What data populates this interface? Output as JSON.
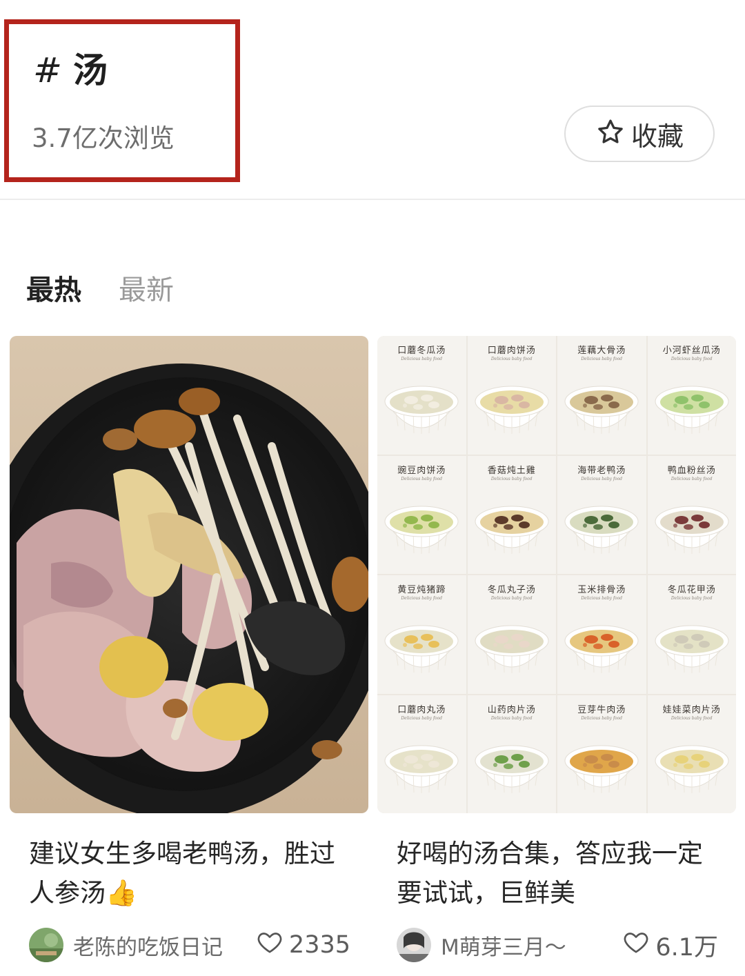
{
  "header": {
    "hash": "#",
    "title": "汤",
    "views": "3.7亿次浏览",
    "collect_label": "收藏"
  },
  "tabs": [
    {
      "label": "最热",
      "active": true
    },
    {
      "label": "最新",
      "active": false
    }
  ],
  "cards": [
    {
      "title": "建议女生多喝老鸭汤，胜过人参汤👍",
      "author": "老陈的吃饭日记",
      "likes": "2335"
    },
    {
      "title": "好喝的汤合集，答应我一定要试试，巨鲜美",
      "author": "M萌芽三月～",
      "likes": "6.1万",
      "grid": [
        {
          "name": "口蘑冬瓜汤",
          "sub": "Delicious baby food"
        },
        {
          "name": "口蘑肉饼汤",
          "sub": "Delicious baby food"
        },
        {
          "name": "莲藕大骨汤",
          "sub": "Delicious baby food"
        },
        {
          "name": "小河虾丝瓜汤",
          "sub": "Delicious baby food"
        },
        {
          "name": "豌豆肉饼汤",
          "sub": "Delicious baby food"
        },
        {
          "name": "香菇炖土雞",
          "sub": "Delicious baby food"
        },
        {
          "name": "海带老鸭汤",
          "sub": "Delicious baby food"
        },
        {
          "name": "鸭血粉丝汤",
          "sub": "Delicious baby food"
        },
        {
          "name": "黄豆炖猪蹄",
          "sub": "Delicious baby food"
        },
        {
          "name": "冬瓜丸子汤",
          "sub": "Delicious baby food"
        },
        {
          "name": "玉米排骨汤",
          "sub": "Delicious baby food"
        },
        {
          "name": "冬瓜花甲汤",
          "sub": "Delicious baby food"
        },
        {
          "name": "口蘑肉丸汤",
          "sub": "Delicious baby food"
        },
        {
          "name": "山药肉片汤",
          "sub": "Delicious baby food"
        },
        {
          "name": "豆芽牛肉汤",
          "sub": "Delicious baby food"
        },
        {
          "name": "娃娃菜肉片汤",
          "sub": "Delicious baby food"
        }
      ]
    }
  ],
  "icons": {
    "collect": "star-outline-icon",
    "like": "heart-outline-icon"
  },
  "colors": {
    "highlight_border": "#b4241c",
    "active_tab": "#222222",
    "inactive_tab": "#9a9a9a"
  }
}
